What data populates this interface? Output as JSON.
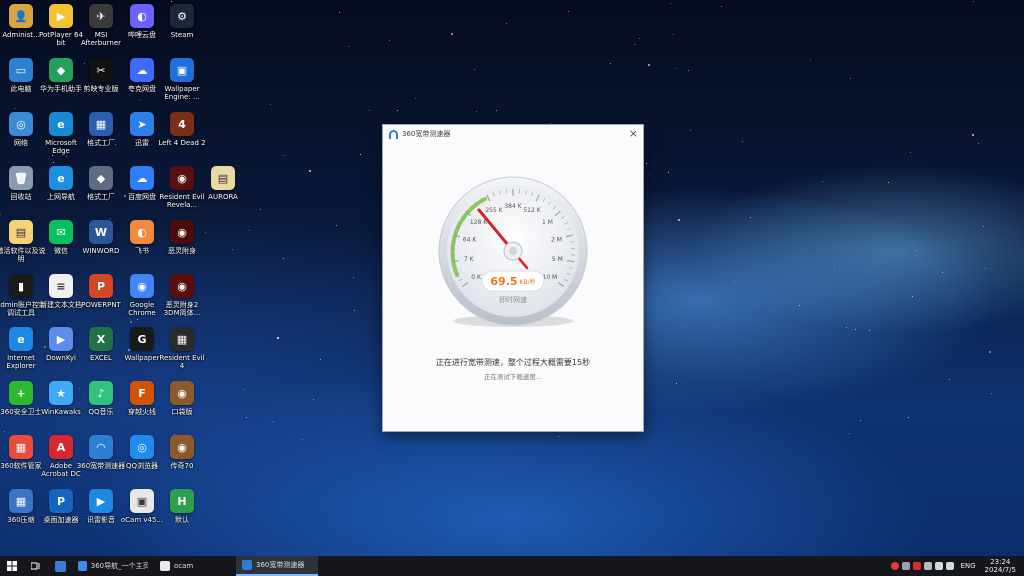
{
  "desktop_icons": [
    {
      "label": "Administ...",
      "color": "#d9a441",
      "glyph": "👤"
    },
    {
      "label": "PotPlayer 64 bit",
      "color": "#f1c232",
      "glyph": "▶"
    },
    {
      "label": "MSI Afterburner",
      "color": "#3a3a3a",
      "glyph": "✈"
    },
    {
      "label": "哔哩云盘",
      "color": "#6c63ff",
      "glyph": "◐"
    },
    {
      "label": "Steam",
      "color": "#1b2838",
      "glyph": "⚙"
    },
    {
      "label": "此电脑",
      "color": "#2f7fd0",
      "glyph": "▭"
    },
    {
      "label": "华为手机助手",
      "color": "#23a05a",
      "glyph": "◆"
    },
    {
      "label": "剪映专业版",
      "color": "#111111",
      "glyph": "✂"
    },
    {
      "label": "夸克网盘",
      "color": "#3b6cff",
      "glyph": "☁"
    },
    {
      "label": "Wallpaper Engine: ...",
      "color": "#1e6fd9",
      "glyph": "▣"
    },
    {
      "label": "网络",
      "color": "#3a8bd6",
      "glyph": "◎"
    },
    {
      "label": "Microsoft Edge",
      "color": "#1a8ad4",
      "glyph": "e"
    },
    {
      "label": "格式工厂",
      "color": "#2a5fb0",
      "glyph": "▦"
    },
    {
      "label": "迅雷",
      "color": "#2c7ee8",
      "glyph": "➤"
    },
    {
      "label": "Left 4 Dead 2",
      "color": "#7a2f16",
      "glyph": "4"
    },
    {
      "label": "回收站",
      "color": "#8a9bb0",
      "glyph": "🗑"
    },
    {
      "label": "上网导航",
      "color": "#1c8fe0",
      "glyph": "e"
    },
    {
      "label": "格式工厂",
      "color": "#5d6c80",
      "glyph": "◆"
    },
    {
      "label": "百度网盘",
      "color": "#2d7ff9",
      "glyph": "☁"
    },
    {
      "label": "Resident Evil Revela...",
      "color": "#5a1010",
      "glyph": "◉"
    },
    {
      "label": "AURORA",
      "color": "#e8d9a5",
      "glyph": "▤"
    },
    {
      "label": "激活软件以及说明",
      "color": "#f5d37a",
      "glyph": "▤"
    },
    {
      "label": "微信",
      "color": "#07c160",
      "glyph": "✉"
    },
    {
      "label": "WINWORD",
      "color": "#2b579a",
      "glyph": "W"
    },
    {
      "label": "飞书",
      "color": "#f08a3c",
      "glyph": "◐"
    },
    {
      "label": "恶灵附身",
      "color": "#4a0d0d",
      "glyph": "◉"
    },
    {
      "label": "admin账户控制调试工具",
      "color": "#1a1a1a",
      "glyph": "▮"
    },
    {
      "label": "新建文本文档",
      "color": "#f0f0f0",
      "glyph": "≡"
    },
    {
      "label": "POWERPNT",
      "color": "#d24726",
      "glyph": "P"
    },
    {
      "label": "Google Chrome",
      "color": "#4285f4",
      "glyph": "◉"
    },
    {
      "label": "恶灵附身2 3DM简体...",
      "color": "#5a0d0d",
      "glyph": "◉"
    },
    {
      "label": "Internet Explorer",
      "color": "#1e88e5",
      "glyph": "e"
    },
    {
      "label": "DownKyi",
      "color": "#5b8def",
      "glyph": "▶"
    },
    {
      "label": "EXCEL",
      "color": "#217346",
      "glyph": "X"
    },
    {
      "label": "Wallpaper",
      "color": "#1a1a1a",
      "glyph": "G"
    },
    {
      "label": "Resident Evil 4",
      "color": "#2a2a2a",
      "glyph": "▦"
    },
    {
      "label": "360安全卫士",
      "color": "#2eb82e",
      "glyph": "+"
    },
    {
      "label": "WinKawaks",
      "color": "#3fa9f5",
      "glyph": "★"
    },
    {
      "label": "QQ音乐",
      "color": "#31c27c",
      "glyph": "♪"
    },
    {
      "label": "穿越火线",
      "color": "#d35400",
      "glyph": "F"
    },
    {
      "label": "口袋版",
      "color": "#8b5a2b",
      "glyph": "◉"
    },
    {
      "label": "360软件管家",
      "color": "#e74c3c",
      "glyph": "▦"
    },
    {
      "label": "Adobe Acrobat DC",
      "color": "#d7282f",
      "glyph": "A"
    },
    {
      "label": "360宽带测速器",
      "color": "#2a7fd4",
      "glyph": "◠"
    },
    {
      "label": "QQ浏览器",
      "color": "#1f8bf0",
      "glyph": "◎"
    },
    {
      "label": "传奇70",
      "color": "#8b5a2b",
      "glyph": "◉"
    },
    {
      "label": "360压缩",
      "color": "#3a74c5",
      "glyph": "▦"
    },
    {
      "label": "桌面加速器",
      "color": "#1565c0",
      "glyph": "P"
    },
    {
      "label": "讯雷影音",
      "color": "#1e88e5",
      "glyph": "▶"
    },
    {
      "label": "oCam v45...",
      "color": "#e8e8e8",
      "glyph": "▣"
    },
    {
      "label": "默认",
      "color": "#2e9e4f",
      "glyph": "H"
    }
  ],
  "dialog": {
    "title": "360宽带测速器",
    "close_label": "×",
    "speed_value": "69.5",
    "speed_unit": "KB/秒",
    "speed_caption": "即时网速",
    "message": "正在进行宽带测速，整个过程大概需要15秒",
    "sub_message": "正在测试下载速度...",
    "gauge_labels": [
      "0 K",
      "7 K",
      "64 K",
      "128 K",
      "255 K",
      "384 K",
      "512 K",
      "1 M",
      "2 M",
      "5 M",
      "10 M"
    ],
    "needle_label": "gauge-needle",
    "accent_color": "#d6202a",
    "speed_color": "#e07818"
  },
  "taskbar": {
    "windows": [
      {
        "label": "360导航_一个主页...",
        "color": "#4285f4"
      },
      {
        "label": "ocam",
        "color": "#e8e8e8"
      },
      {
        "label": "360宽带测速器",
        "color": "#2a7fd4",
        "active": true
      }
    ],
    "lang": "ENG",
    "time": "23:24",
    "date": "2024/7/5"
  }
}
